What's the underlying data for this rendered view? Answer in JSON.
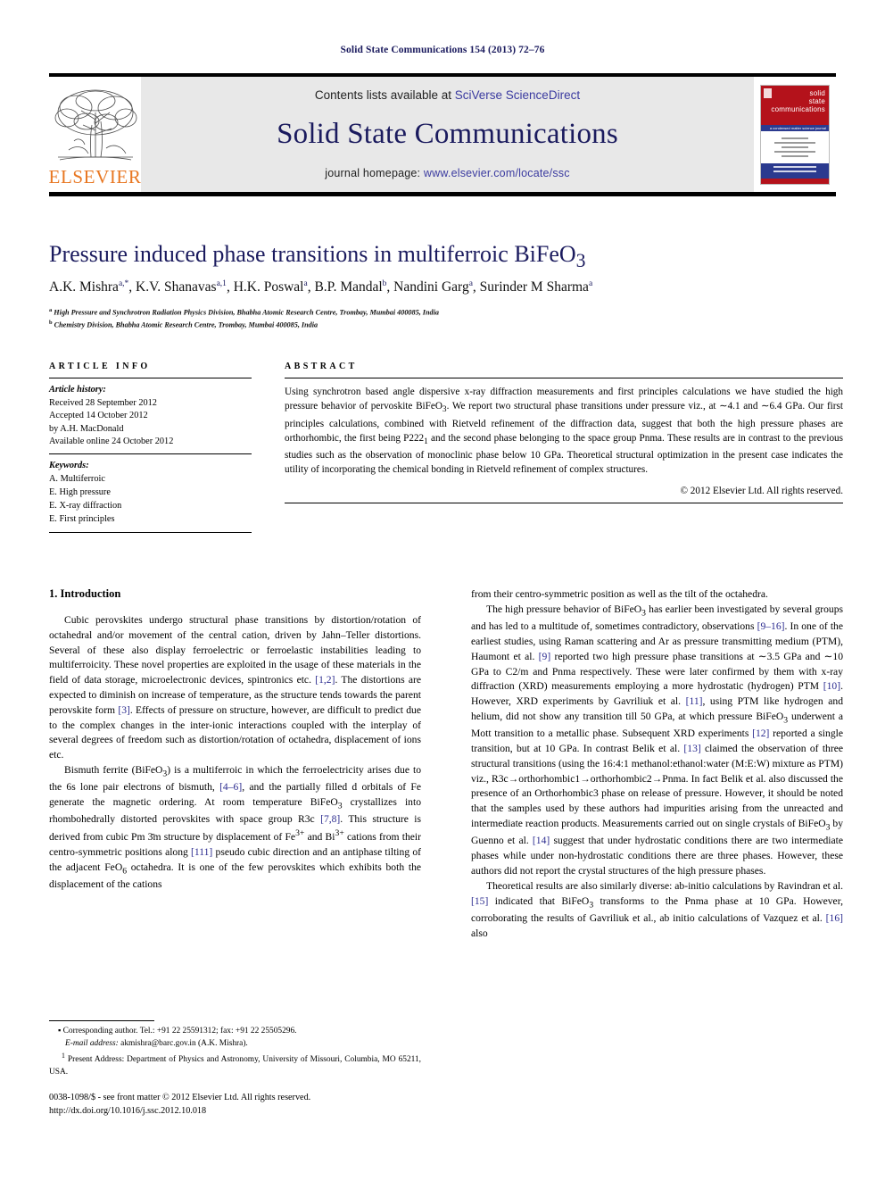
{
  "running_head": "Solid State Communications 154 (2013) 72–76",
  "masthead": {
    "publisher_wordmark": "ELSEVIER",
    "contents_prefix": "Contents lists available at ",
    "contents_link": "SciVerse ScienceDirect",
    "journal_name": "Solid State Communications",
    "homepage_prefix": "journal homepage: ",
    "homepage_link": "www.elsevier.com/locate/ssc",
    "cover": {
      "line1": "solid",
      "line2": "state",
      "line3": "communications",
      "tagline": "a condensed matter science journal"
    }
  },
  "article": {
    "title": "Pressure induced phase transitions in multiferroic BiFeO",
    "title_sub": "3",
    "authors": "A.K. Mishra, K.V. Shanavas, H.K. Poswal, B.P. Mandal, Nandini Garg, Surinder M Sharma",
    "affiliation_a": "High Pressure and Synchrotron Radiation Physics Division, Bhabha Atomic Research Centre, Trombay, Mumbai 400085, India",
    "affiliation_b": "Chemistry Division, Bhabha Atomic Research Centre, Trombay, Mumbai 400085, India"
  },
  "info": {
    "heading": "ARTICLE INFO",
    "history_label": "Article history:",
    "history": [
      "Received 28 September 2012",
      "Accepted 14 October 2012",
      "by A.H. MacDonald",
      "Available online 24 October 2012"
    ],
    "keywords_label": "Keywords:",
    "keywords": [
      "A. Multiferroic",
      "E. High pressure",
      "E. X-ray diffraction",
      "E. First principles"
    ]
  },
  "abstract": {
    "heading": "ABSTRACT",
    "text": "Using synchrotron based angle dispersive x-ray diffraction measurements and first principles calculations we have studied the high pressure behavior of pervoskite BiFeO3. We report two structural phase transitions under pressure viz., at ∼4.1 and ∼6.4 GPa. Our first principles calculations, combined with Rietveld refinement of the diffraction data, suggest that both the high pressure phases are orthorhombic, the first being P2221 and the second phase belonging to the space group Pnma. These results are in contrast to the previous studies such as the observation of monoclinic phase below 10 GPa. Theoretical structural optimization in the present case indicates the utility of incorporating the chemical bonding in Rietveld refinement of complex structures.",
    "copyright": "© 2012 Elsevier Ltd. All rights reserved."
  },
  "body": {
    "section1_heading": "1. Introduction",
    "left_paragraphs": [
      "Cubic perovskites undergo structural phase transitions by distortion/rotation of octahedral and/or movement of the central cation, driven by Jahn–Teller distortions. Several of these also display ferroelectric or ferroelastic instabilities leading to multiferroicity. These novel properties are exploited in the usage of these materials in the field of data storage, microelectronic devices, spintronics etc. [1,2]. The distortions are expected to diminish on increase of temperature, as the structure tends towards the parent perovskite form [3]. Effects of pressure on structure, however, are difficult to predict due to the complex changes in the inter-ionic interactions coupled with the interplay of several degrees of freedom such as distortion/rotation of octahedra, displacement of ions etc.",
      "Bismuth ferrite (BiFeO3) is a multiferroic in which the ferroelectricity arises due to the 6s lone pair electrons of bismuth, [4–6], and the partially filled d orbitals of Fe generate the magnetic ordering. At room temperature BiFeO3 crystallizes into rhombohedrally distorted perovskites with space group R3c [7,8]. This structure is derived from cubic Pm 3̄m structure by displacement of Fe3+ and Bi3+ cations from their centro-symmetric positions along [111] pseudo cubic direction and an antiphase tilting of the adjacent FeO6 octahedra. It is one of the few perovskites which exhibits both the displacement of the cations"
    ],
    "right_paragraphs": [
      "from their centro-symmetric position as well as the tilt of the octahedra.",
      "The high pressure behavior of BiFeO3 has earlier been investigated by several groups and has led to a multitude of, sometimes contradictory, observations [9–16]. In one of the earliest studies, using Raman scattering and Ar as pressure transmitting medium (PTM), Haumont et al. [9] reported two high pressure phase transitions at ∼3.5 GPa and ∼10 GPa to C2/m and Pnma respectively. These were later confirmed by them with x-ray diffraction (XRD) measurements employing a more hydrostatic (hydrogen) PTM [10]. However, XRD experiments by Gavriliuk et al. [11], using PTM like hydrogen and helium, did not show any transition till 50 GPa, at which pressure BiFeO3 underwent a Mott transition to a metallic phase. Subsequent XRD experiments [12] reported a single transition, but at 10 GPa. In contrast Belik et al. [13] claimed the observation of three structural transitions (using the 16:4:1 methanol:ethanol:water (M:E:W) mixture as PTM) viz., R3c→orthorhombic1→orthorhombic2→Pnma. In fact Belik et al. also discussed the presence of an Orthorhombic3 phase on release of pressure. However, it should be noted that the samples used by these authors had impurities arising from the unreacted and intermediate reaction products. Measurements carried out on single crystals of BiFeO3 by Guenno et al. [14] suggest that under hydrostatic conditions there are two intermediate phases while under non-hydrostatic conditions there are three phases. However, these authors did not report the crystal structures of the high pressure phases.",
      "Theoretical results are also similarly diverse: ab-initio calculations by Ravindran et al. [15] indicated that BiFeO3 transforms to the Pnma phase at 10 GPa. However, corroborating the results of Gavriliuk et al., ab initio calculations of Vazquez et al. [16] also"
    ]
  },
  "footnotes": {
    "corresponding": "Corresponding author. Tel.: +91 22 25591312; fax: +91 22 25505296.",
    "email_label": "E-mail address:",
    "email": "akmishra@barc.gov.in (A.K. Mishra).",
    "present_address": "Present Address: Department of Physics and Astronomy, University of Missouri, Columbia, MO 65211, USA.",
    "issn_line": "0038-1098/$ - see front matter © 2012 Elsevier Ltd. All rights reserved.",
    "doi_line": "http://dx.doi.org/10.1016/j.ssc.2012.10.018"
  },
  "colors": {
    "journal_blue": "#1b1b5e",
    "link_blue": "#3b3ba0",
    "ref_blue": "#2b2b8f",
    "elsevier_orange": "#E87722",
    "cover_red": "#b4121b"
  }
}
